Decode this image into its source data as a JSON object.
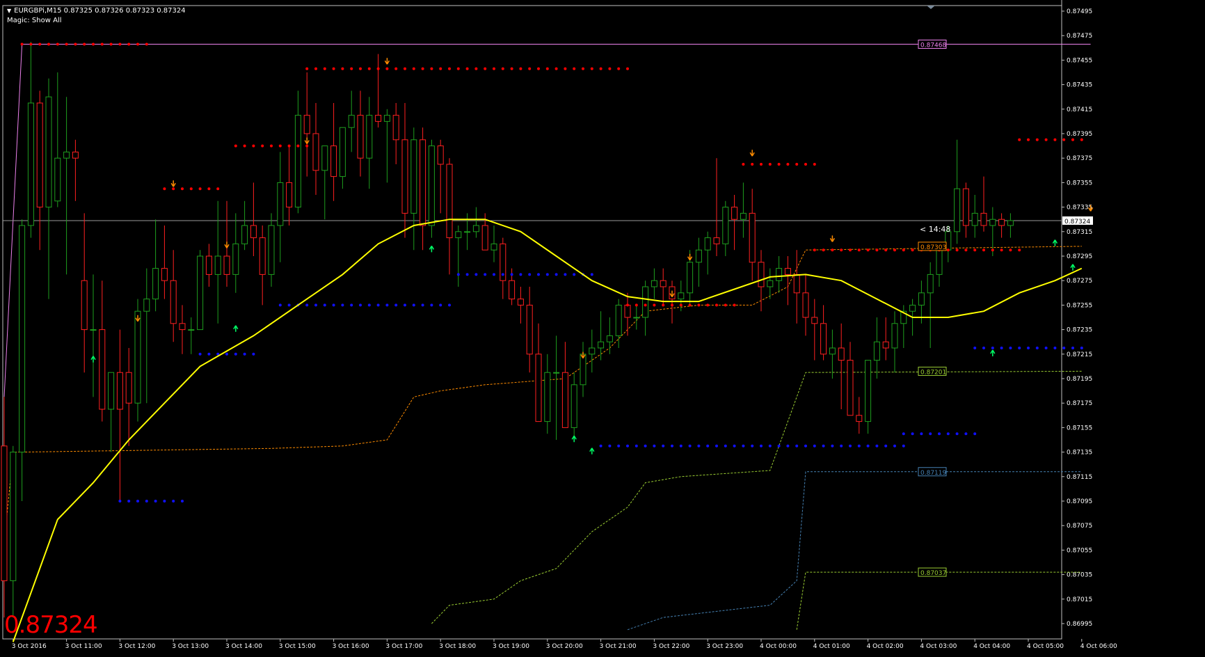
{
  "header": {
    "symbol_line": "EURGBPi,M15  0.87325 0.87326 0.87323 0.87324",
    "magic_line": "Magic: Show All"
  },
  "big_price": "0.87324",
  "countdown": "< 14:48",
  "colors": {
    "background": "#000000",
    "bull": "#1e9e1e",
    "bear": "#ff2020",
    "ma": "#ffff00",
    "res_dots": "#ff0000",
    "sup_dots": "#1010ff",
    "orange": "#ff8c00",
    "green_line": "#9acd32",
    "blue_line": "#4682b4",
    "magenta": "#ee82ee",
    "grid_text": "#ffffff"
  },
  "chart_data": {
    "type": "candlestick",
    "symbol": "EURGBPi",
    "timeframe": "M15",
    "ylim": [
      0.86985,
      0.875
    ],
    "yticks": [
      "0.87495",
      "0.87475",
      "0.87455",
      "0.87435",
      "0.87415",
      "0.87395",
      "0.87375",
      "0.87355",
      "0.87335",
      "0.87315",
      "0.87295",
      "0.87275",
      "0.87255",
      "0.87235",
      "0.87215",
      "0.87195",
      "0.87175",
      "0.87155",
      "0.87135",
      "0.87115",
      "0.87095",
      "0.87075",
      "0.87055",
      "0.87035",
      "0.87015",
      "0.86995"
    ],
    "xticks": [
      {
        "i": 1,
        "label": "3 Oct 2016"
      },
      {
        "i": 7,
        "label": "3 Oct 11:00"
      },
      {
        "i": 13,
        "label": "3 Oct 12:00"
      },
      {
        "i": 19,
        "label": "3 Oct 13:00"
      },
      {
        "i": 25,
        "label": "3 Oct 14:00"
      },
      {
        "i": 31,
        "label": "3 Oct 15:00"
      },
      {
        "i": 37,
        "label": "3 Oct 16:00"
      },
      {
        "i": 43,
        "label": "3 Oct 17:00"
      },
      {
        "i": 49,
        "label": "3 Oct 18:00"
      },
      {
        "i": 55,
        "label": "3 Oct 19:00"
      },
      {
        "i": 61,
        "label": "3 Oct 20:00"
      },
      {
        "i": 67,
        "label": "3 Oct 21:00"
      },
      {
        "i": 73,
        "label": "3 Oct 22:00"
      },
      {
        "i": 79,
        "label": "3 Oct 23:00"
      },
      {
        "i": 85,
        "label": "4 Oct 00:00"
      },
      {
        "i": 91,
        "label": "4 Oct 01:00"
      },
      {
        "i": 97,
        "label": "4 Oct 02:00"
      },
      {
        "i": 103,
        "label": "4 Oct 03:00"
      },
      {
        "i": 109,
        "label": "4 Oct 04:00"
      },
      {
        "i": 115,
        "label": "4 Oct 05:00"
      },
      {
        "i": 121,
        "label": "4 Oct 06:00"
      }
    ],
    "candles": [
      [
        0.8714,
        0.8718,
        0.87,
        0.8703
      ],
      [
        0.8703,
        0.8714,
        0.87,
        0.87135
      ],
      [
        0.87135,
        0.87325,
        0.87095,
        0.8732
      ],
      [
        0.8732,
        0.8747,
        0.8731,
        0.8742
      ],
      [
        0.8742,
        0.8743,
        0.873,
        0.87335
      ],
      [
        0.87335,
        0.8744,
        0.8726,
        0.87425
      ],
      [
        0.8734,
        0.87445,
        0.87335,
        0.87375
      ],
      [
        0.87375,
        0.87425,
        0.8728,
        0.8738
      ],
      [
        0.8738,
        0.8739,
        0.8734,
        0.87375
      ],
      [
        0.87275,
        0.8733,
        0.872,
        0.87235
      ],
      [
        0.87235,
        0.8728,
        0.8718,
        0.87235
      ],
      [
        0.87235,
        0.87275,
        0.8716,
        0.8717
      ],
      [
        0.8717,
        0.8718,
        0.87135,
        0.872
      ],
      [
        0.872,
        0.87235,
        0.87095,
        0.8717
      ],
      [
        0.872,
        0.8722,
        0.8714,
        0.87175
      ],
      [
        0.87175,
        0.8726,
        0.8716,
        0.8725
      ],
      [
        0.8725,
        0.87285,
        0.87175,
        0.8726
      ],
      [
        0.8726,
        0.87325,
        0.8725,
        0.87285
      ],
      [
        0.87285,
        0.8732,
        0.8726,
        0.87275
      ],
      [
        0.87275,
        0.873,
        0.87225,
        0.8724
      ],
      [
        0.8724,
        0.87255,
        0.87215,
        0.87235
      ],
      [
        0.87235,
        0.87245,
        0.87215,
        0.87235
      ],
      [
        0.87235,
        0.873,
        0.87235,
        0.87295
      ],
      [
        0.87295,
        0.87305,
        0.8727,
        0.8728
      ],
      [
        0.8728,
        0.8734,
        0.8724,
        0.87295
      ],
      [
        0.87295,
        0.8734,
        0.8727,
        0.8728
      ],
      [
        0.8728,
        0.8733,
        0.87265,
        0.87305
      ],
      [
        0.87305,
        0.8734,
        0.873,
        0.8732
      ],
      [
        0.8732,
        0.87355,
        0.87295,
        0.8731
      ],
      [
        0.8731,
        0.8732,
        0.87255,
        0.8728
      ],
      [
        0.8728,
        0.8733,
        0.8727,
        0.8732
      ],
      [
        0.8732,
        0.8738,
        0.8729,
        0.87355
      ],
      [
        0.87355,
        0.87385,
        0.8732,
        0.87335
      ],
      [
        0.87335,
        0.8743,
        0.8733,
        0.8741
      ],
      [
        0.8741,
        0.87445,
        0.8736,
        0.87395
      ],
      [
        0.87395,
        0.8742,
        0.87345,
        0.87365
      ],
      [
        0.87365,
        0.8738,
        0.87325,
        0.87385
      ],
      [
        0.87385,
        0.8742,
        0.8734,
        0.8736
      ],
      [
        0.8736,
        0.87385,
        0.8735,
        0.874
      ],
      [
        0.874,
        0.8743,
        0.8738,
        0.8741
      ],
      [
        0.8741,
        0.8743,
        0.8736,
        0.87375
      ],
      [
        0.87375,
        0.87425,
        0.8735,
        0.8741
      ],
      [
        0.8741,
        0.8746,
        0.874,
        0.87405
      ],
      [
        0.87405,
        0.87415,
        0.87355,
        0.8741
      ],
      [
        0.8741,
        0.8742,
        0.8737,
        0.8739
      ],
      [
        0.8739,
        0.8742,
        0.8731,
        0.8733
      ],
      [
        0.8733,
        0.874,
        0.873,
        0.8739
      ],
      [
        0.8739,
        0.874,
        0.873,
        0.8732
      ],
      [
        0.8732,
        0.8739,
        0.8731,
        0.87385
      ],
      [
        0.87385,
        0.8739,
        0.8733,
        0.8737
      ],
      [
        0.8737,
        0.87375,
        0.8728,
        0.8731
      ],
      [
        0.8731,
        0.8732,
        0.8727,
        0.87315
      ],
      [
        0.87315,
        0.8733,
        0.873,
        0.87315
      ],
      [
        0.87315,
        0.87335,
        0.8731,
        0.8732
      ],
      [
        0.8732,
        0.8733,
        0.8731,
        0.873
      ],
      [
        0.873,
        0.8732,
        0.8729,
        0.87305
      ],
      [
        0.87305,
        0.8731,
        0.8726,
        0.87275
      ],
      [
        0.87275,
        0.87285,
        0.87255,
        0.8726
      ],
      [
        0.8726,
        0.8727,
        0.8724,
        0.87255
      ],
      [
        0.87255,
        0.8727,
        0.872,
        0.87215
      ],
      [
        0.87215,
        0.8724,
        0.8718,
        0.8716
      ],
      [
        0.8716,
        0.87215,
        0.8715,
        0.872
      ],
      [
        0.872,
        0.8723,
        0.87145,
        0.872
      ],
      [
        0.872,
        0.87225,
        0.8717,
        0.87155
      ],
      [
        0.87155,
        0.872,
        0.87145,
        0.8719
      ],
      [
        0.8719,
        0.87225,
        0.8718,
        0.87215
      ],
      [
        0.87215,
        0.87235,
        0.872,
        0.8722
      ],
      [
        0.8722,
        0.8725,
        0.8721,
        0.87225
      ],
      [
        0.87225,
        0.87245,
        0.87215,
        0.8723
      ],
      [
        0.8723,
        0.8726,
        0.8722,
        0.87255
      ],
      [
        0.87255,
        0.87265,
        0.8723,
        0.87245
      ],
      [
        0.87245,
        0.87255,
        0.87235,
        0.87245
      ],
      [
        0.87245,
        0.87275,
        0.8723,
        0.8727
      ],
      [
        0.8727,
        0.87285,
        0.8726,
        0.87275
      ],
      [
        0.87275,
        0.87285,
        0.87255,
        0.8727
      ],
      [
        0.8727,
        0.87275,
        0.8724,
        0.8726
      ],
      [
        0.8726,
        0.87275,
        0.8725,
        0.87265
      ],
      [
        0.87265,
        0.873,
        0.87255,
        0.8729
      ],
      [
        0.8729,
        0.8731,
        0.8727,
        0.873
      ],
      [
        0.873,
        0.87315,
        0.8728,
        0.8731
      ],
      [
        0.8731,
        0.87375,
        0.87295,
        0.87305
      ],
      [
        0.87305,
        0.8734,
        0.87295,
        0.87335
      ],
      [
        0.87335,
        0.87345,
        0.873,
        0.87325
      ],
      [
        0.87325,
        0.87355,
        0.8731,
        0.8733
      ],
      [
        0.8733,
        0.8735,
        0.87275,
        0.8729
      ],
      [
        0.8729,
        0.873,
        0.8725,
        0.8727
      ],
      [
        0.8727,
        0.87285,
        0.8726,
        0.87275
      ],
      [
        0.87275,
        0.87295,
        0.87265,
        0.87285
      ],
      [
        0.87285,
        0.87295,
        0.87255,
        0.8728
      ],
      [
        0.8728,
        0.873,
        0.8724,
        0.87265
      ],
      [
        0.87265,
        0.8728,
        0.8723,
        0.87245
      ],
      [
        0.87245,
        0.8726,
        0.8721,
        0.8724
      ],
      [
        0.8724,
        0.87255,
        0.8721,
        0.87215
      ],
      [
        0.87215,
        0.87235,
        0.87195,
        0.8722
      ],
      [
        0.8722,
        0.8724,
        0.8717,
        0.8721
      ],
      [
        0.8721,
        0.87225,
        0.87165,
        0.87165
      ],
      [
        0.87165,
        0.8718,
        0.8715,
        0.8716
      ],
      [
        0.8716,
        0.8721,
        0.8715,
        0.8721
      ],
      [
        0.8721,
        0.87245,
        0.87195,
        0.87225
      ],
      [
        0.87225,
        0.87245,
        0.8721,
        0.8722
      ],
      [
        0.8722,
        0.8725,
        0.872,
        0.8724
      ],
      [
        0.8724,
        0.87255,
        0.8722,
        0.8725
      ],
      [
        0.8725,
        0.8726,
        0.8723,
        0.87255
      ],
      [
        0.87255,
        0.87275,
        0.8724,
        0.87265
      ],
      [
        0.87265,
        0.8729,
        0.8722,
        0.8728
      ],
      [
        0.8728,
        0.87305,
        0.8727,
        0.873
      ],
      [
        0.873,
        0.8732,
        0.8729,
        0.87315
      ],
      [
        0.87315,
        0.8739,
        0.87305,
        0.8735
      ],
      [
        0.8735,
        0.87355,
        0.8731,
        0.8732
      ],
      [
        0.8732,
        0.87345,
        0.8731,
        0.8733
      ],
      [
        0.8733,
        0.8736,
        0.87315,
        0.8732
      ],
      [
        0.8732,
        0.87335,
        0.87295,
        0.87325
      ],
      [
        0.87325,
        0.8733,
        0.8731,
        0.8732
      ],
      [
        0.8732,
        0.8733,
        0.8731,
        0.87324
      ]
    ],
    "ma_line": [
      [
        1,
        0.8698
      ],
      [
        6,
        0.8708
      ],
      [
        10,
        0.8711
      ],
      [
        14,
        0.87145
      ],
      [
        18,
        0.87175
      ],
      [
        22,
        0.87205
      ],
      [
        28,
        0.8723
      ],
      [
        34,
        0.8726
      ],
      [
        38,
        0.8728
      ],
      [
        42,
        0.87305
      ],
      [
        46,
        0.8732
      ],
      [
        50,
        0.87325
      ],
      [
        54,
        0.87325
      ],
      [
        58,
        0.87315
      ],
      [
        62,
        0.87295
      ],
      [
        66,
        0.87275
      ],
      [
        70,
        0.87262
      ],
      [
        74,
        0.87258
      ],
      [
        78,
        0.87258
      ],
      [
        82,
        0.87268
      ],
      [
        86,
        0.87278
      ],
      [
        90,
        0.8728
      ],
      [
        94,
        0.87275
      ],
      [
        98,
        0.8726
      ],
      [
        102,
        0.87245
      ],
      [
        106,
        0.87245
      ],
      [
        110,
        0.8725
      ],
      [
        114,
        0.87265
      ],
      [
        118,
        0.87275
      ],
      [
        121,
        0.87285
      ]
    ],
    "res_dots": [
      {
        "price": 0.87468,
        "from": 2,
        "to": 16
      },
      {
        "price": 0.87448,
        "from": 34,
        "to": 70
      },
      {
        "price": 0.87385,
        "from": 26,
        "to": 34
      },
      {
        "price": 0.8735,
        "from": 18,
        "to": 24
      },
      {
        "price": 0.8737,
        "from": 83,
        "to": 91
      },
      {
        "price": 0.873,
        "from": 91,
        "to": 114
      },
      {
        "price": 0.8739,
        "from": 114,
        "to": 121
      },
      {
        "price": 0.87255,
        "from": 70,
        "to": 82
      }
    ],
    "sup_dots": [
      {
        "price": 0.87095,
        "from": 13,
        "to": 20
      },
      {
        "price": 0.87215,
        "from": 22,
        "to": 28
      },
      {
        "price": 0.87255,
        "from": 31,
        "to": 50
      },
      {
        "price": 0.8728,
        "from": 51,
        "to": 66
      },
      {
        "price": 0.8714,
        "from": 67,
        "to": 101
      },
      {
        "price": 0.8715,
        "from": 101,
        "to": 109
      },
      {
        "price": 0.8722,
        "from": 109,
        "to": 121
      }
    ],
    "up_arrows": [
      [
        10,
        0.87215
      ],
      [
        26,
        0.8724
      ],
      [
        48,
        0.87305
      ],
      [
        64,
        0.8715
      ],
      [
        66,
        0.8714
      ],
      [
        111,
        0.8722
      ],
      [
        118,
        0.8731
      ],
      [
        120,
        0.8729
      ]
    ],
    "down_arrows": [
      [
        15,
        0.8724
      ],
      [
        19,
        0.8735
      ],
      [
        25,
        0.873
      ],
      [
        34,
        0.87385
      ],
      [
        43,
        0.8745
      ],
      [
        65,
        0.8721
      ],
      [
        75,
        0.8726
      ],
      [
        77,
        0.8729
      ],
      [
        84,
        0.87375
      ],
      [
        93,
        0.87305
      ],
      [
        122,
        0.8733
      ]
    ],
    "level_lines": [
      {
        "label": "0.87468",
        "price": 0.87468,
        "color": "#ee82ee"
      },
      {
        "label": "0.87303",
        "price": 0.87303,
        "color": "#ff8c00"
      },
      {
        "label": "0.87201",
        "price": 0.87201,
        "color": "#9acd32"
      },
      {
        "label": "0.87119",
        "price": 0.87119,
        "color": "#4682b4"
      },
      {
        "label": "0.87037",
        "price": 0.87037,
        "color": "#9acd32"
      }
    ],
    "current_price": {
      "label": "0.87324",
      "price": 0.87324
    }
  }
}
